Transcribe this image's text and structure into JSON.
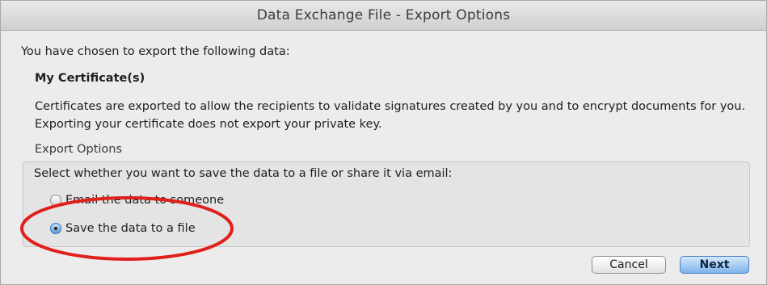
{
  "window": {
    "title": "Data Exchange File - Export Options"
  },
  "content": {
    "intro": "You have chosen to export the following data:",
    "data_name": "My Certificate(s)",
    "description": "Certificates are exported to allow the recipients to validate signatures created by you and to encrypt documents for you. Exporting your certificate does not export your private key.",
    "section_label": "Export Options",
    "prompt": "Select whether you want to save the data to a file or share it via email:",
    "options": [
      {
        "label": "Email the data to someone",
        "selected": false
      },
      {
        "label": "Save the data to a file",
        "selected": true
      }
    ]
  },
  "buttons": {
    "cancel": "Cancel",
    "next": "Next"
  },
  "annotation": {
    "shape": "ellipse",
    "color": "#e0201b"
  }
}
